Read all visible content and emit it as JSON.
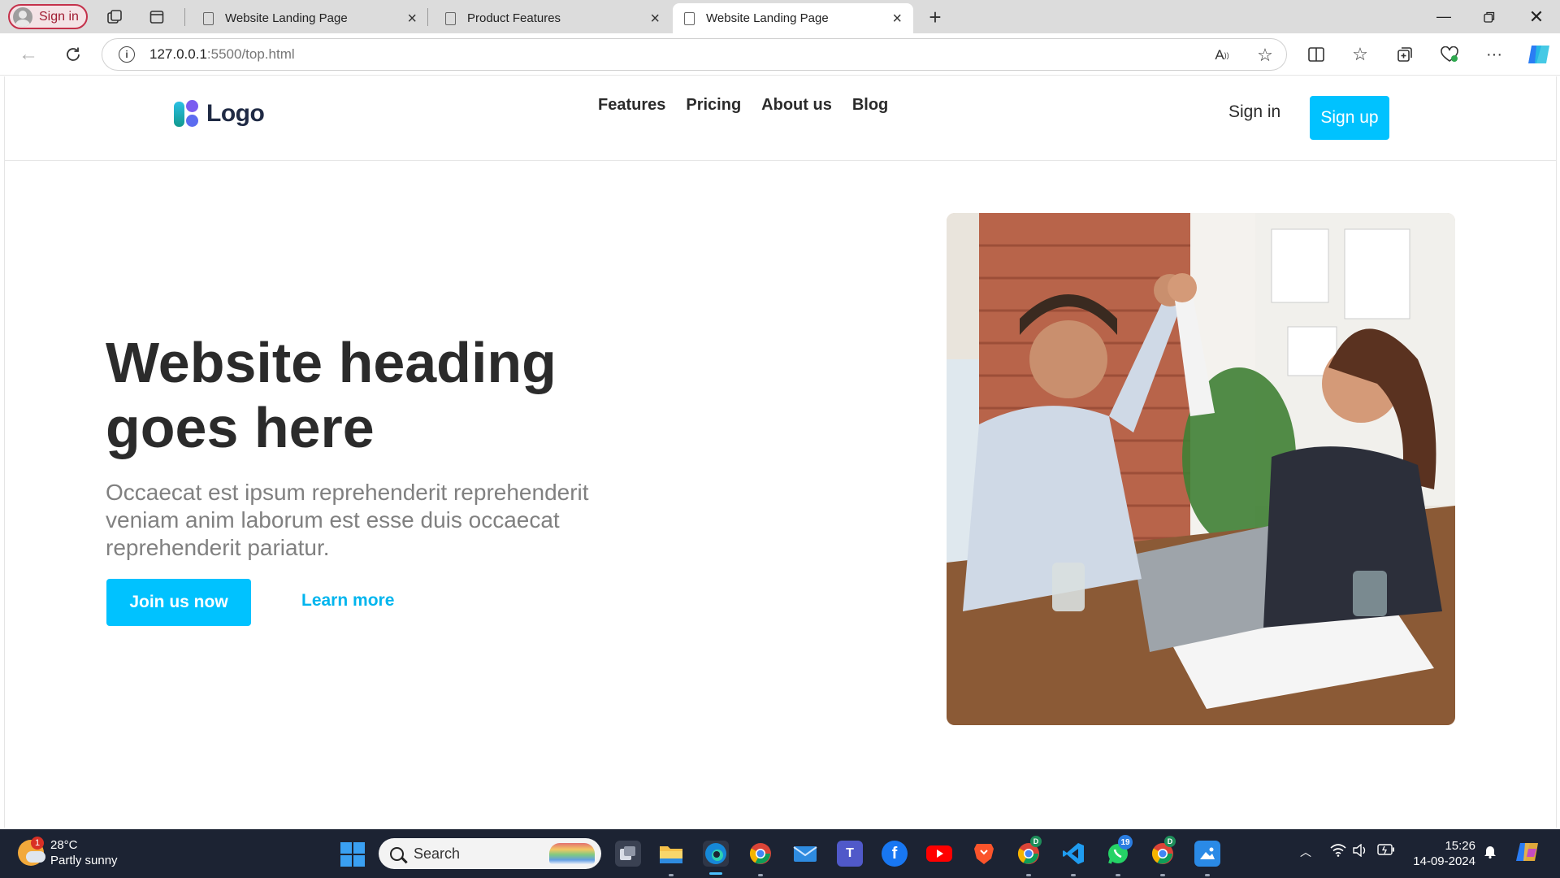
{
  "browser": {
    "profile_label": "Sign in",
    "tabs": [
      {
        "title": "Website Landing Page",
        "active": false
      },
      {
        "title": "Product Features",
        "active": false
      },
      {
        "title": "Website Landing Page",
        "active": true
      }
    ],
    "url_host": "127.0.0.1",
    "url_rest": ":5500/top.html"
  },
  "site": {
    "logo_text": "Logo",
    "nav": [
      "Features",
      "Pricing",
      "About us",
      "Blog"
    ],
    "signin": "Sign in",
    "signup": "Sign up",
    "hero": {
      "heading_line1": "Website heading",
      "heading_line2": "goes here",
      "subtext": "Occaecat est ipsum reprehenderit reprehenderit veniam anim laborum est esse duis occaecat reprehenderit pariatur.",
      "primary_cta": "Join us now",
      "secondary_cta": "Learn more"
    },
    "colors": {
      "accent": "#00c2ff",
      "heading": "#2b2b2b",
      "subtext": "#808080"
    }
  },
  "taskbar": {
    "weather_temp": "28°C",
    "weather_desc": "Partly sunny",
    "weather_badge": "1",
    "search_placeholder": "Search",
    "whatsapp_badge": "19",
    "chrome_badge": "D",
    "time": "15:26",
    "date": "14-09-2024"
  }
}
